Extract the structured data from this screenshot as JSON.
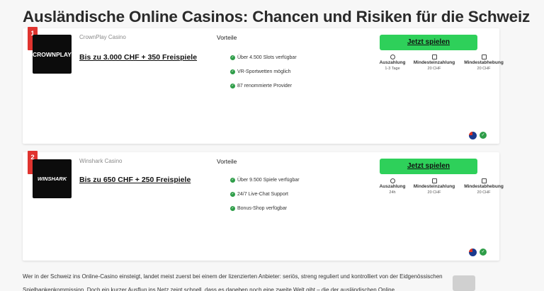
{
  "page": {
    "title": "Ausländische Online Casinos: Chancen und Risiken für die Schweiz"
  },
  "casinos": [
    {
      "rank": "1",
      "logo_text": "CROWNPLAY",
      "name": "CrownPlay Casino",
      "bonus": "Bis zu 3.000 CHF + 350 Freispiele",
      "vorteile_heading": "Vorteile",
      "vorteile": [
        "Über 4.500 Slots verfügbar",
        "VR-Sportwetten möglich",
        "87 renommierte Provider"
      ],
      "play_label": "Jetzt spielen",
      "stats": [
        {
          "label": "Auszahlung",
          "value": "1-3 Tage"
        },
        {
          "label": "Mindesteinzahlung",
          "value": "20 CHF"
        },
        {
          "label": "Mindestabhebung",
          "value": "20 CHF"
        }
      ]
    },
    {
      "rank": "2",
      "logo_text": "WINSHARK",
      "name": "Winshark Casino",
      "bonus": "Bis zu 650 CHF + 250 Freispiele",
      "vorteile_heading": "Vorteile",
      "vorteile": [
        "Über 9.500 Spiele verfügbar",
        "24/7 Live-Chat Support",
        "Bonus-Shop verfügbar"
      ],
      "play_label": "Jetzt spielen",
      "stats": [
        {
          "label": "Auszahlung",
          "value": "24h"
        },
        {
          "label": "Mindesteinzahlung",
          "value": "20 CHF"
        },
        {
          "label": "Mindestabhebung",
          "value": "20 CHF"
        }
      ]
    }
  ],
  "body_text": "Wer in der Schweiz ins Online-Casino einsteigt, landet meist zuerst bei einem der lizenzierten Anbieter: seriös, streng reguliert und kontrolliert von der Eidgenössischen Spielbankenkommission. Doch ein kurzer Ausflug ins Netz zeigt schnell, dass es daneben noch eine zweite Welt gibt – die der ausländischen Online",
  "colors": {
    "play_button": "#2ed05a",
    "rank_badge": "#e0342f",
    "check": "#2e9d48"
  }
}
